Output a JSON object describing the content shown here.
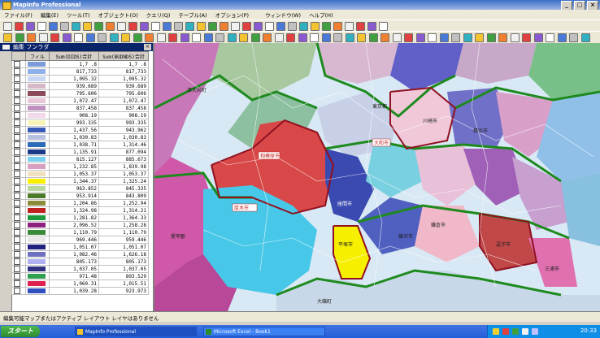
{
  "window": {
    "title": "MapInfo Professional"
  },
  "menu": [
    "ファイル(F)",
    "編集(E)",
    "ツール(T)",
    "オブジェクト(O)",
    "クエリ(Q)",
    "テーブル(A)",
    "オプション(P)",
    "",
    "ウィンドウ(W)",
    "ヘルプ(H)"
  ],
  "browser": {
    "title": "編集 フンラダ",
    "columns": [
      "",
      "フィル",
      "Sum(DIDS)合計",
      "Sum(BUDNDS)合計"
    ],
    "rows": [
      {
        "fill": "#7a9ad8",
        "v1": "1,7 .8",
        "v2": "1,7 .8"
      },
      {
        "fill": "#8fb0e8",
        "v1": "817,733",
        "v2": "817,733"
      },
      {
        "fill": "#c8d7f4",
        "v1": "1,095.32",
        "v2": "1,095.32"
      },
      {
        "fill": "#d6b8c8",
        "v1": "939.689",
        "v2": "939.689"
      },
      {
        "fill": "#8b4a5a",
        "v1": "795.606",
        "v2": "795.606"
      },
      {
        "fill": "#e8c8d8",
        "v1": "1,072.47",
        "v2": "1,072.47"
      },
      {
        "fill": "#c090c0",
        "v1": "837.458",
        "v2": "837.458"
      },
      {
        "fill": "#f2d8e8",
        "v1": "908.19",
        "v2": "908.19"
      },
      {
        "fill": "#f8f4b8",
        "v1": "993.335",
        "v2": "993.335"
      },
      {
        "fill": "#3a5ab8",
        "v1": "1,437.56",
        "v2": "943.962"
      },
      {
        "fill": "#b8c0e0",
        "v1": "1,030.83",
        "v2": "1,030.83"
      },
      {
        "fill": "#2a6ab8",
        "v1": "1,038.71",
        "v2": "1,314.46"
      },
      {
        "fill": "#1a3a88",
        "v1": "1,135.91",
        "v2": "877.094"
      },
      {
        "fill": "#7ad0f0",
        "v1": "815.127",
        "v2": "885.673"
      },
      {
        "fill": "#d8a0c0",
        "v1": "1,232.85",
        "v2": "1,839.98"
      },
      {
        "fill": "#f0e0c0",
        "v1": "1,053.37",
        "v2": "1,053.37"
      },
      {
        "fill": "#f8f000",
        "v1": "1,344.37",
        "v2": "1,325.24"
      },
      {
        "fill": "#b8d8a0",
        "v1": "963.852",
        "v2": "845.335"
      },
      {
        "fill": "#4a7a2a",
        "v1": "953.914",
        "v2": "843.809"
      },
      {
        "fill": "#8a8a3a",
        "v1": "1,204.86",
        "v2": "1,252.94"
      },
      {
        "fill": "#c02020",
        "v1": "1,324.98",
        "v2": "1,314.21"
      },
      {
        "fill": "#1a9a3a",
        "v1": "1,281.82",
        "v2": "1,364.33"
      },
      {
        "fill": "#902080",
        "v1": "2,096.52",
        "v2": "1,258.28"
      },
      {
        "fill": "#3a8a3a",
        "v1": "1,110.79",
        "v2": "1,110.79"
      },
      {
        "fill": "#e8e8e8",
        "v1": "969.446",
        "v2": "959.446"
      },
      {
        "fill": "#202080",
        "v1": "1,051.07",
        "v2": "1,051.07"
      },
      {
        "fill": "#7070c0",
        "v1": "1,082.46",
        "v2": "1,626.18"
      },
      {
        "fill": "#b0b0f0",
        "v1": "805.173",
        "v2": "805.173"
      },
      {
        "fill": "#303080",
        "v1": "1,037.05",
        "v2": "1,037.05"
      },
      {
        "fill": "#30a050",
        "v1": "971.48",
        "v2": "803.529"
      },
      {
        "fill": "#e02050",
        "v1": "1,060.31",
        "v2": "1,015.51"
      },
      {
        "fill": "#3050c0",
        "v1": "1,039.28",
        "v2": "923.973"
      }
    ]
  },
  "map": {
    "labels": [
      "東京都",
      "綾瀬市",
      "座間市",
      "大磯町",
      "秦野市",
      "厚木市",
      "相模原市",
      "町田市",
      "横浜市",
      "藤沢市",
      "茅ヶ崎市",
      "鎌倉市",
      "逗子市",
      "三浦市",
      "平塚市",
      "伊勢原市",
      "海老名市",
      "大和市",
      "川崎市"
    ],
    "districts": [
      "津久井町",
      "愛甲郡",
      "小田原市"
    ]
  },
  "status": {
    "left": "編集可能マップまたはアクティブ レイアウト レイヤはありません",
    "right": ""
  },
  "taskbar": {
    "start": "スタート",
    "buttons": [
      "MapInfo Professional",
      "Microsoft Excel - Book1"
    ],
    "clock": "20:33"
  }
}
